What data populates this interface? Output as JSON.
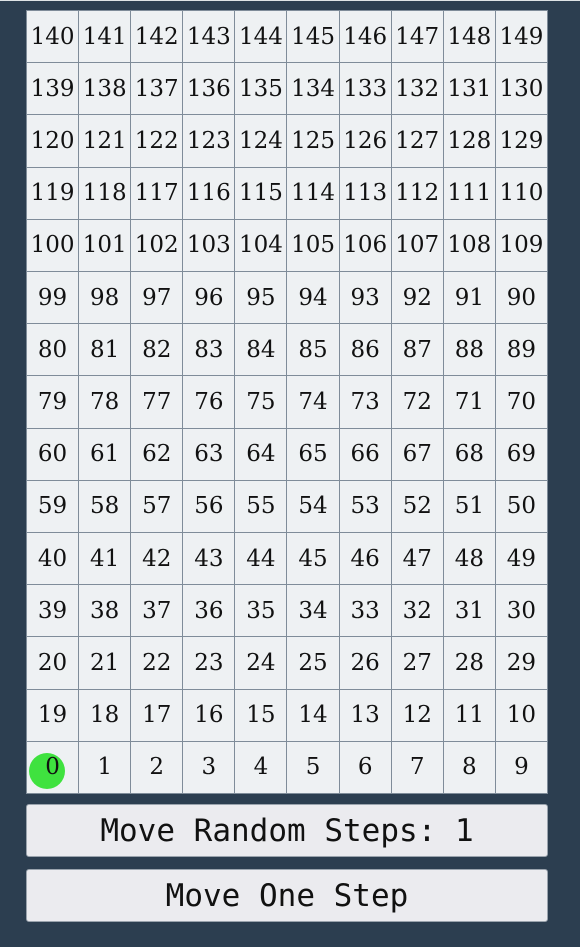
{
  "board": {
    "rows": [
      [
        140,
        141,
        142,
        143,
        144,
        145,
        146,
        147,
        148,
        149
      ],
      [
        139,
        138,
        137,
        136,
        135,
        134,
        133,
        132,
        131,
        130
      ],
      [
        120,
        121,
        122,
        123,
        124,
        125,
        126,
        127,
        128,
        129
      ],
      [
        119,
        118,
        117,
        116,
        115,
        114,
        113,
        112,
        111,
        110
      ],
      [
        100,
        101,
        102,
        103,
        104,
        105,
        106,
        107,
        108,
        109
      ],
      [
        99,
        98,
        97,
        96,
        95,
        94,
        93,
        92,
        91,
        90
      ],
      [
        80,
        81,
        82,
        83,
        84,
        85,
        86,
        87,
        88,
        89
      ],
      [
        79,
        78,
        77,
        76,
        75,
        74,
        73,
        72,
        71,
        70
      ],
      [
        60,
        61,
        62,
        63,
        64,
        65,
        66,
        67,
        68,
        69
      ],
      [
        59,
        58,
        57,
        56,
        55,
        54,
        53,
        52,
        51,
        50
      ],
      [
        40,
        41,
        42,
        43,
        44,
        45,
        46,
        47,
        48,
        49
      ],
      [
        39,
        38,
        37,
        36,
        35,
        34,
        33,
        32,
        31,
        30
      ],
      [
        20,
        21,
        22,
        23,
        24,
        25,
        26,
        27,
        28,
        29
      ],
      [
        19,
        18,
        17,
        16,
        15,
        14,
        13,
        12,
        11,
        10
      ],
      [
        0,
        1,
        2,
        3,
        4,
        5,
        6,
        7,
        8,
        9
      ]
    ],
    "token_position": 0,
    "token_color": "#3fe23f",
    "background_color": "#2c3e50",
    "cell_color": "#eef1f3"
  },
  "controls": {
    "move_random_label": "Move Random Steps: 1",
    "move_one_label": "Move One Step"
  }
}
